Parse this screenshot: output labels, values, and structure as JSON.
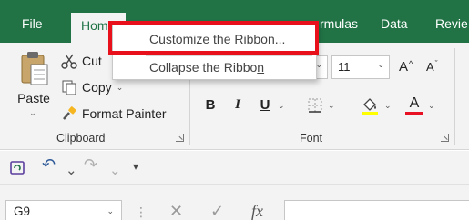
{
  "tabs": {
    "file": "File",
    "home": "Hom",
    "formulas_fragment": "rmulas",
    "data": "Data",
    "review_fragment": "Revie"
  },
  "clipboard": {
    "paste": "Paste",
    "cut": "Cut",
    "copy": "Copy",
    "format_painter": "Format Painter",
    "group_label": "Clipboard"
  },
  "font": {
    "size": "11",
    "grow": "A",
    "shrink": "A",
    "bold": "B",
    "italic": "I",
    "underline": "U",
    "font_color_letter": "A",
    "group_label": "Font"
  },
  "context_menu": {
    "customize_prefix": "Customize the ",
    "customize_accel": "R",
    "customize_suffix": "ibbon...",
    "collapse_prefix": "Collapse the Ribbo",
    "collapse_accel": "n"
  },
  "formula_bar": {
    "name_box": "G9",
    "fx": "fx",
    "cancel": "✕",
    "enter": "✓"
  },
  "colors": {
    "tab_green": "#217346",
    "highlight_red": "#e8101b",
    "font_color_red": "#e81123",
    "highlight_yellow": "#ffff00"
  }
}
